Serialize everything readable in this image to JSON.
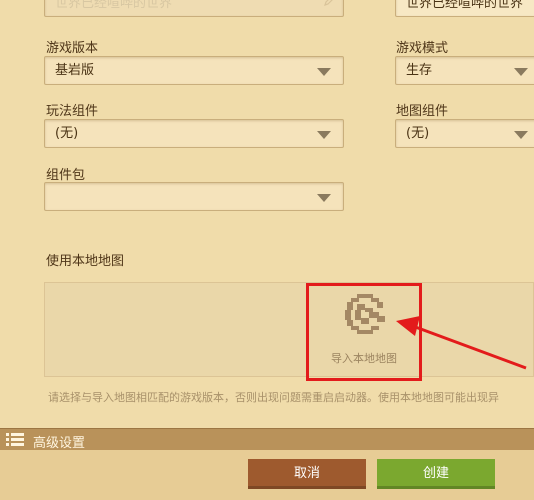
{
  "form": {
    "world_name_placeholder": "世界已经喧哗的世界",
    "world_name_right_value": "世界已经喧哗的世界",
    "game_version": {
      "label": "游戏版本",
      "value": "基岩版"
    },
    "game_mode": {
      "label": "游戏模式",
      "value": "生存"
    },
    "gameplay_component": {
      "label": "玩法组件",
      "value": "(无)"
    },
    "map_component": {
      "label": "地图组件",
      "value": "(无)"
    },
    "component_pack": {
      "label": "组件包",
      "value": ""
    },
    "local_map": {
      "label": "使用本地地图",
      "import_label": "导入本地地图"
    },
    "hint": "请选择与导入地图相匹配的游戏版本，否则出现问题需重启启动器。使用本地地图可能出现异"
  },
  "advanced": {
    "label": "高级设置"
  },
  "actions": {
    "cancel_label": "取消",
    "create_label": "创建"
  },
  "colors": {
    "background": "#f0dcaa",
    "highlight": "#e31b1b",
    "cancel": "#9e5a2e",
    "create": "#7ba82f"
  },
  "icons": [
    "pencil-icon",
    "chevron-down-icon",
    "import-map-icon",
    "menu-list-icon"
  ]
}
